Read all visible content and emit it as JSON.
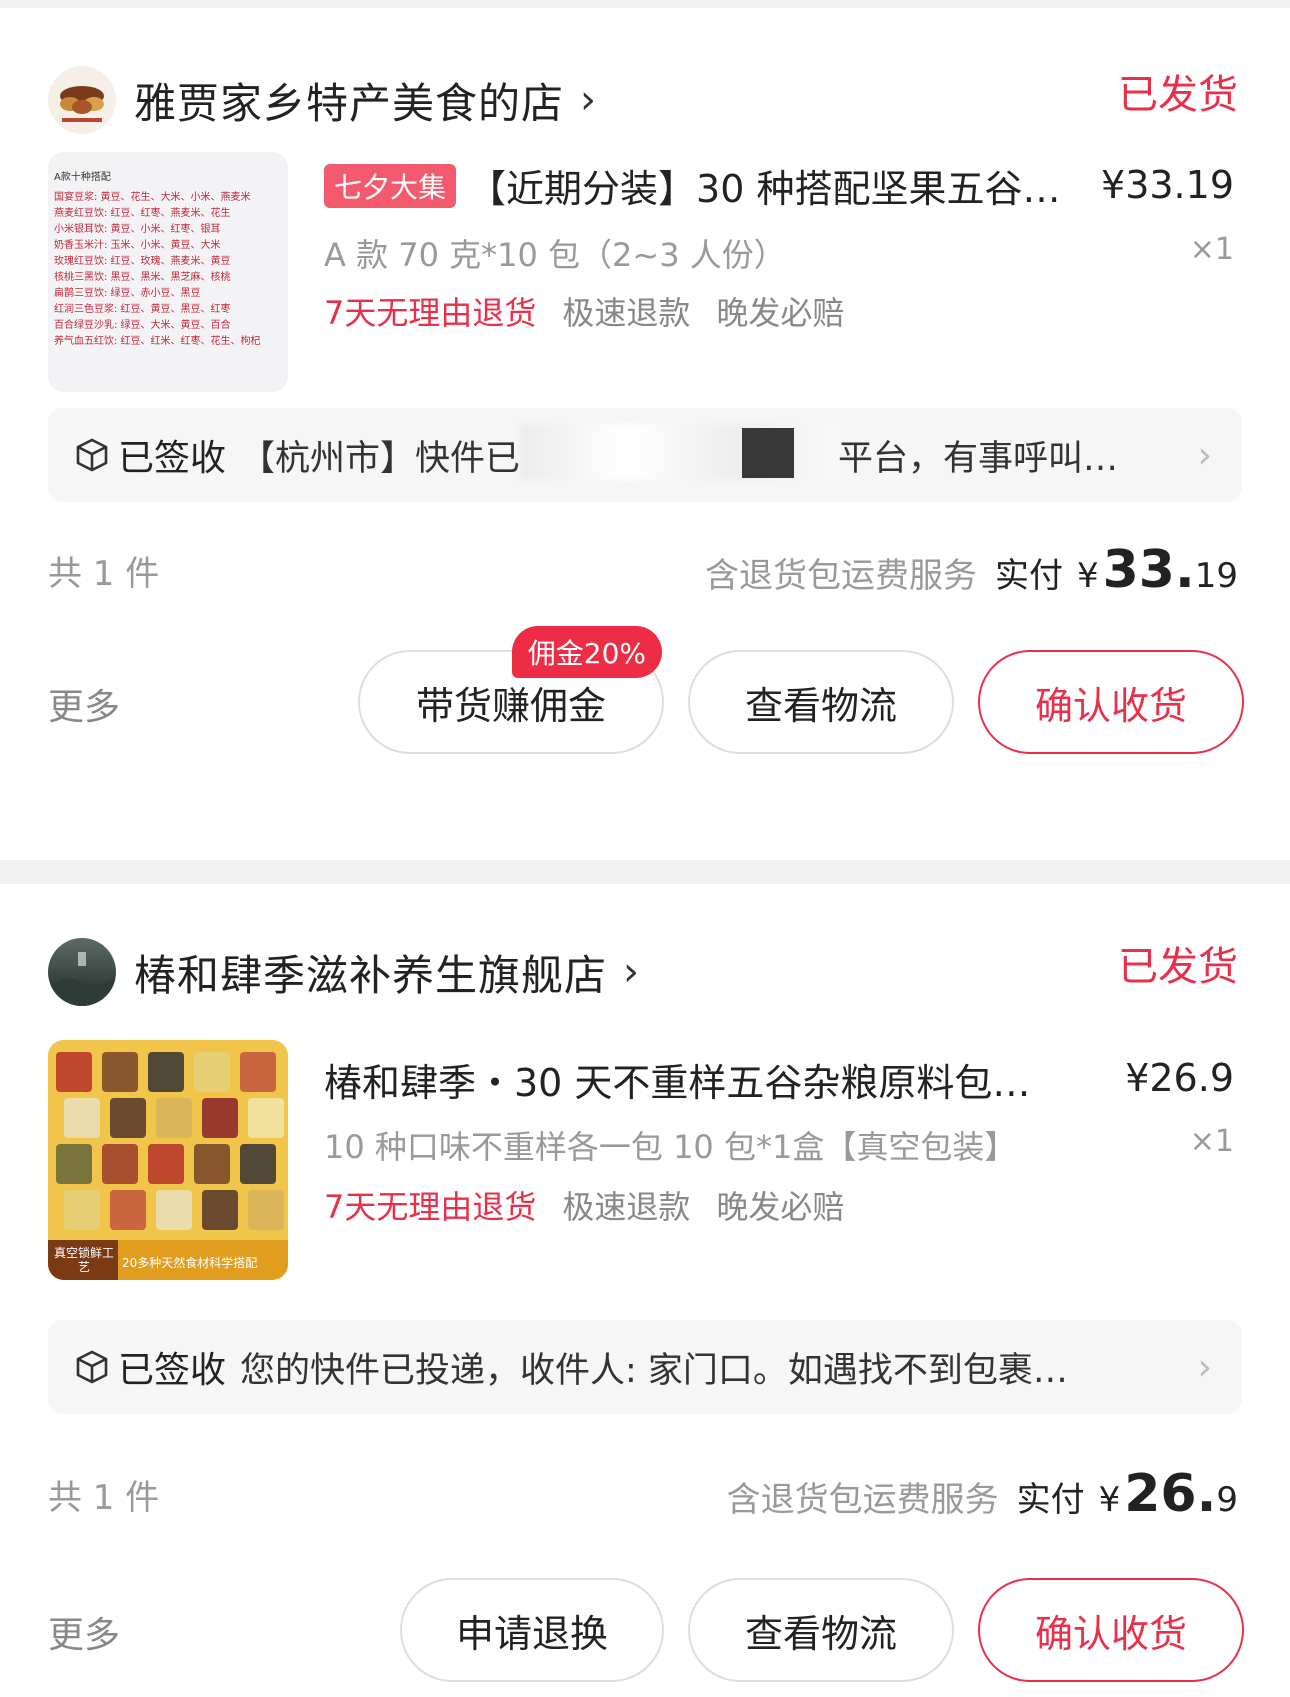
{
  "orders": [
    {
      "shop_name": "雅贾家乡特产美食的店",
      "status": "已发货",
      "tag": "七夕大集",
      "title": "【近期分装】30 种搭配坚果五谷…",
      "price": "¥33.19",
      "spec": "A 款 70 克*10 包（2~3 人份）",
      "qty": "×1",
      "guarantees": [
        "7天无理由退货",
        "极速退款",
        "晚发必赔"
      ],
      "logistics_status": "已签收",
      "logistics_text_pre": "【杭州市】快件已",
      "logistics_text_post": "平台，有事呼叫…",
      "count": "共 1 件",
      "service": "含退货包运费服务",
      "paid_label": "实付",
      "yen": "¥",
      "amount_int": "33.",
      "amount_dec": "19",
      "more": "更多",
      "buttons": [
        "带货赚佣金",
        "查看物流",
        "确认收货"
      ],
      "commission_badge": "佣金20%",
      "thumb_lines": [
        "A款十种搭配",
        "国宴豆浆: 黄豆、花生、大米、小米、燕麦米",
        "燕麦红豆饮: 红豆、红枣、燕麦米、花生",
        "小米银耳饮: 黄豆、小米、红枣、银耳",
        "奶香玉米汁: 玉米、小米、黄豆、大米",
        "玫瑰红豆饮: 红豆、玫瑰、燕麦米、黄豆",
        "核桃三黑饮: 黑豆、黑米、黑芝麻、核桃",
        "扁鹊三豆饮: 绿豆、赤小豆、黑豆",
        "红润三色豆浆: 红豆、黄豆、黑豆、红枣",
        "百合绿豆沙乳: 绿豆、大米、黄豆、百合",
        "养气血五红饮: 红豆、红米、红枣、花生、枸杞"
      ]
    },
    {
      "shop_name": "椿和肆季滋补养生旗舰店",
      "status": "已发货",
      "title": "椿和肆季・30 天不重样五谷杂粮原料包…",
      "price": "¥26.9",
      "spec": "10 种口味不重样各一包 10 包*1盒【真空包装】",
      "qty": "×1",
      "guarantees": [
        "7天无理由退货",
        "极速退款",
        "晚发必赔"
      ],
      "logistics_status": "已签收",
      "logistics_text": "您的快件已投递，收件人: 家门口。如遇找不到包裹…",
      "count": "共 1 件",
      "service": "含退货包运费服务",
      "paid_label": "实付",
      "yen": "¥",
      "amount_int": "26.",
      "amount_dec": "9",
      "more": "更多",
      "buttons": [
        "申请退换",
        "查看物流",
        "确认收货"
      ],
      "thumb_caption_left": "真空锁鲜工艺",
      "thumb_caption_right": "20多种天然食材科学搭配"
    }
  ],
  "colors": {
    "accent_red": "#e8304a",
    "text": "#222222",
    "muted": "#999999"
  },
  "icons": [
    "chevron-right-icon",
    "package-box-icon"
  ]
}
